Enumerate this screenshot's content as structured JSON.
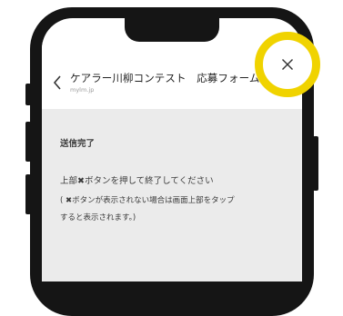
{
  "header": {
    "title": "ケアラー川柳コンテスト　応募フォーム",
    "subtitle": "mylm.jp",
    "back_icon": "chevron-left-icon",
    "close_icon": "close-icon"
  },
  "content": {
    "heading": "送信完了",
    "instruction": "上部✖ボタンを押して終了してください",
    "note_line1": "( ✖ボタンが表示されない場合は画面上部をタップ",
    "note_line2": "すると表示されます。)"
  },
  "colors": {
    "highlight": "#f0d300",
    "phone_frame": "#151515",
    "content_bg": "#ebebeb"
  }
}
